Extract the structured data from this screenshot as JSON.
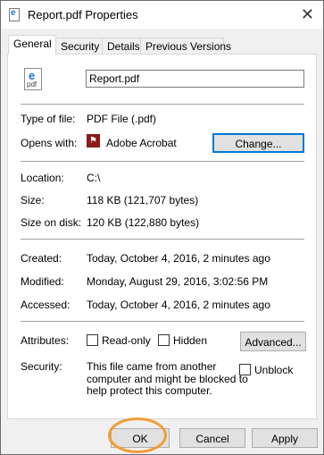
{
  "window": {
    "title": "Report.pdf Properties",
    "close_glyph": "✕"
  },
  "tabs": [
    "General",
    "Security",
    "Details",
    "Previous Versions"
  ],
  "file": {
    "name": "Report.pdf",
    "icon_letter": "e",
    "icon_text": "pdf"
  },
  "type_of_file": {
    "label": "Type of file:",
    "value": "PDF File (.pdf)"
  },
  "opens_with": {
    "label": "Opens with:",
    "value": "Adobe Acrobat",
    "button": "Change..."
  },
  "location": {
    "label": "Location:",
    "value": "C:\\"
  },
  "size": {
    "label": "Size:",
    "value": "118 KB (121,707 bytes)"
  },
  "size_on_disk": {
    "label": "Size on disk:",
    "value": "120 KB (122,880 bytes)"
  },
  "created": {
    "label": "Created:",
    "value": "Today, October 4, 2016, 2 minutes ago"
  },
  "modified": {
    "label": "Modified:",
    "value": "Monday, August 29, 2016, 3:02:56 PM"
  },
  "accessed": {
    "label": "Accessed:",
    "value": "Today, October 4, 2016, 2 minutes ago"
  },
  "attributes": {
    "label": "Attributes:",
    "readonly": "Read-only",
    "hidden": "Hidden",
    "advanced": "Advanced..."
  },
  "security": {
    "label": "Security:",
    "line1": "This file came from another",
    "line2": "computer and might be blocked to",
    "line3": "help protect this computer.",
    "unblock": "Unblock"
  },
  "buttons": {
    "ok": "OK",
    "cancel": "Cancel",
    "apply": "Apply"
  },
  "colors": {
    "highlight": "#f39c34",
    "focus": "#0078d7",
    "acrobat": "#8b1a1a"
  }
}
